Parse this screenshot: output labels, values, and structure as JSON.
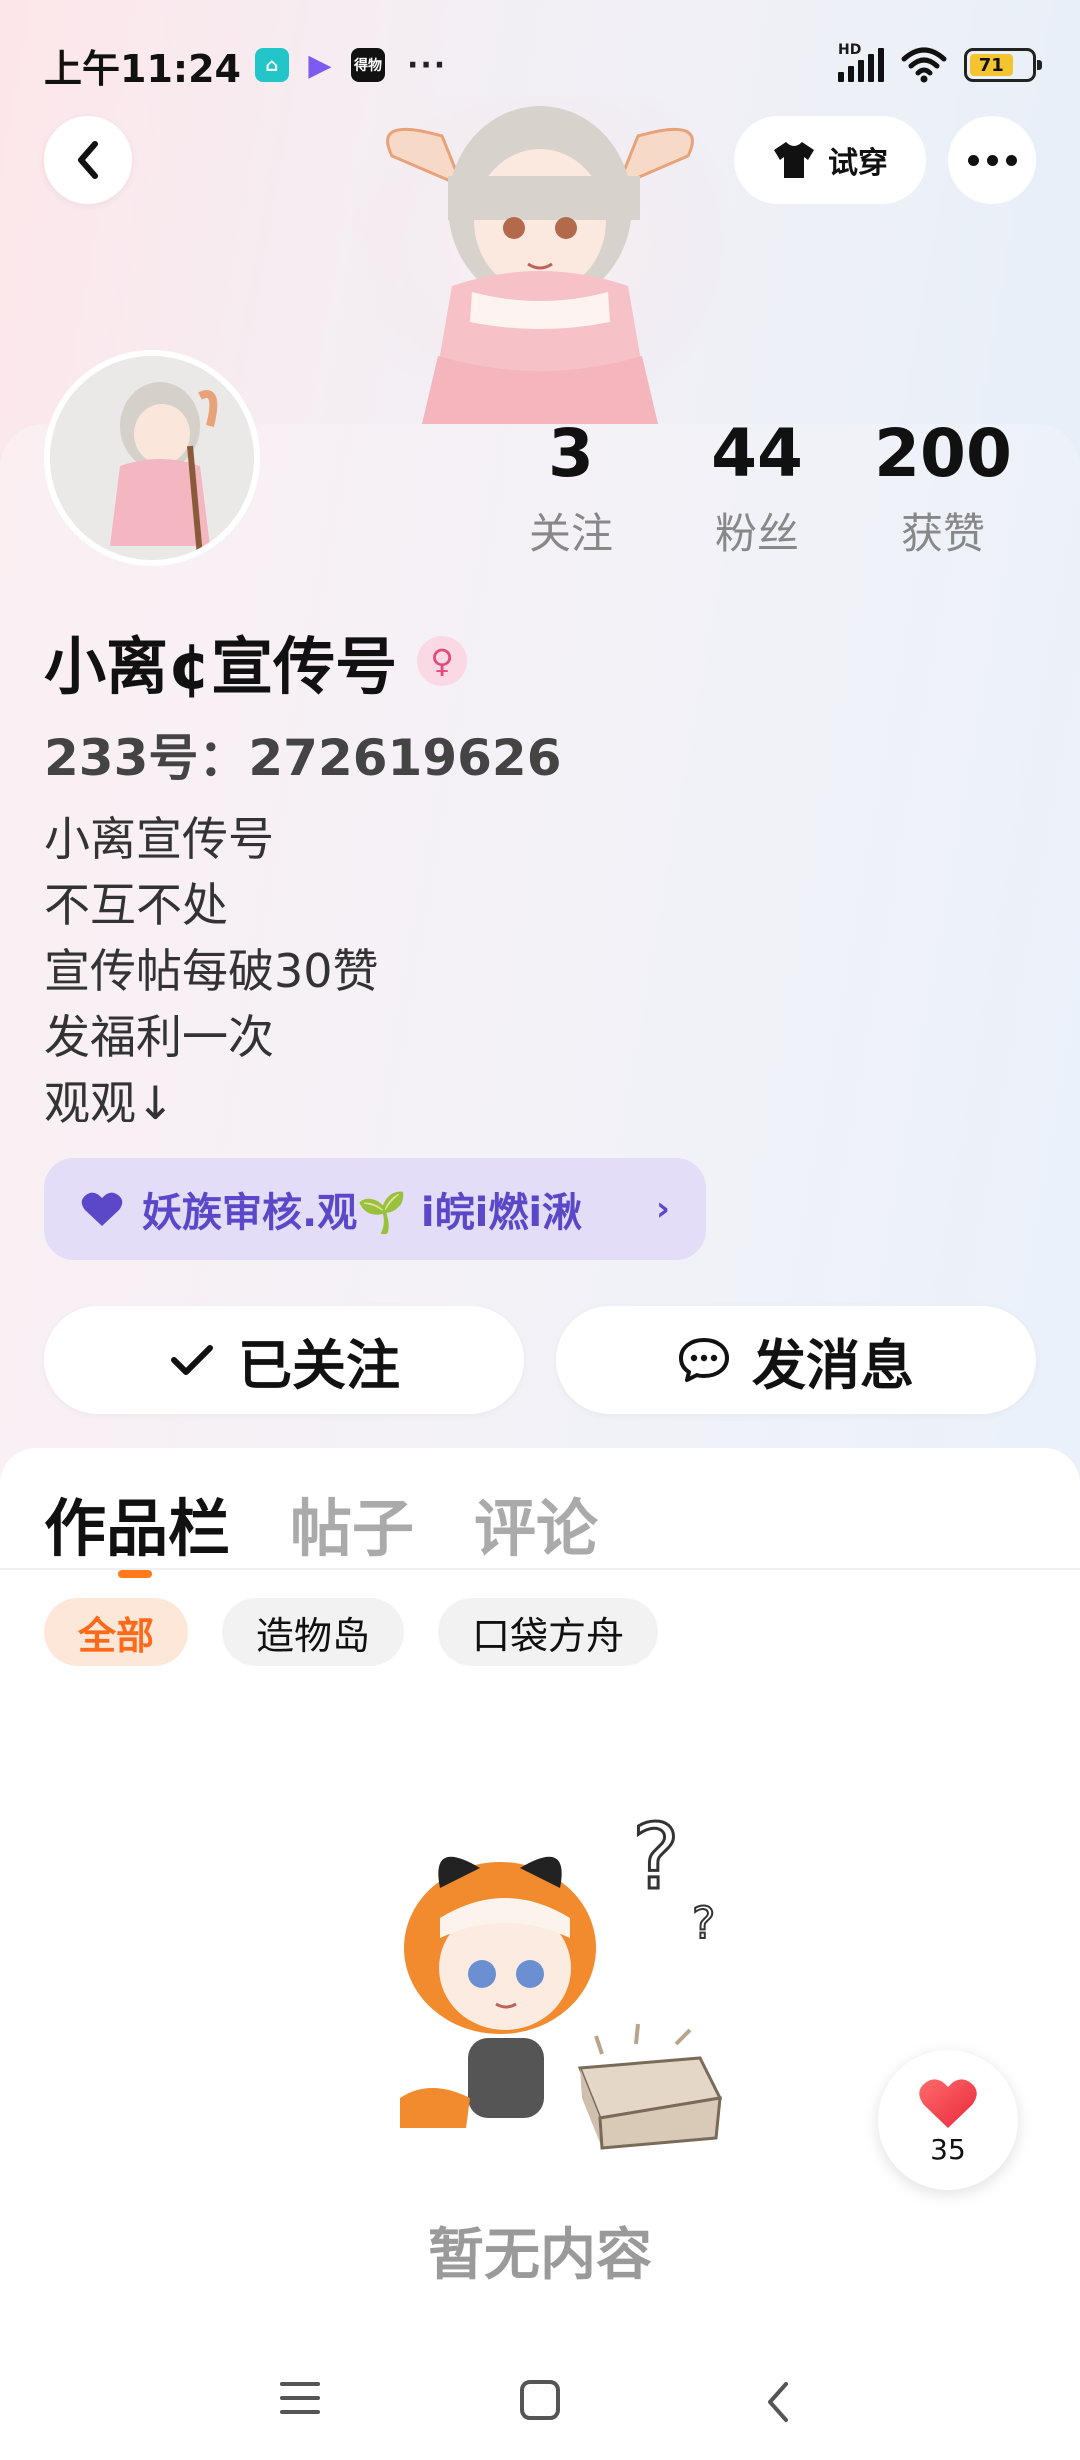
{
  "status_bar": {
    "time": "上午11:24",
    "app_icon_1": "⌂",
    "app_icon_2": "▶",
    "app_icon_3": "得物",
    "more": "···",
    "network": "HD",
    "battery_level": 71,
    "battery_label": "71"
  },
  "header": {
    "tryon_label": "试穿"
  },
  "stats": [
    {
      "value": "3",
      "label": "关注"
    },
    {
      "value": "44",
      "label": "粉丝"
    },
    {
      "value": "200",
      "label": "获赞"
    }
  ],
  "profile": {
    "nickname": "小离¢宣传号",
    "gender_symbol": "♀",
    "uid": "233号：272619626",
    "bio_lines": [
      "小离宣传号",
      "不互不处",
      "宣传帖每破30赞",
      "发福利一次",
      "观观↓"
    ]
  },
  "group_chip": {
    "label": "妖族审核.观🌱 i皖i燃i湫",
    "chevron": "›"
  },
  "actions": {
    "follow_label": "已关注",
    "message_label": "发消息"
  },
  "tabs": [
    "作品栏",
    "帖子",
    "评论"
  ],
  "filters": [
    "全部",
    "造物岛",
    "口袋方舟"
  ],
  "empty_state": {
    "text": "暂无内容"
  },
  "like_float": {
    "count": "35"
  },
  "colors": {
    "accent": "#ff6a1a",
    "chip_purple": "#5a48c8",
    "heart_red": "#f03a4a"
  }
}
